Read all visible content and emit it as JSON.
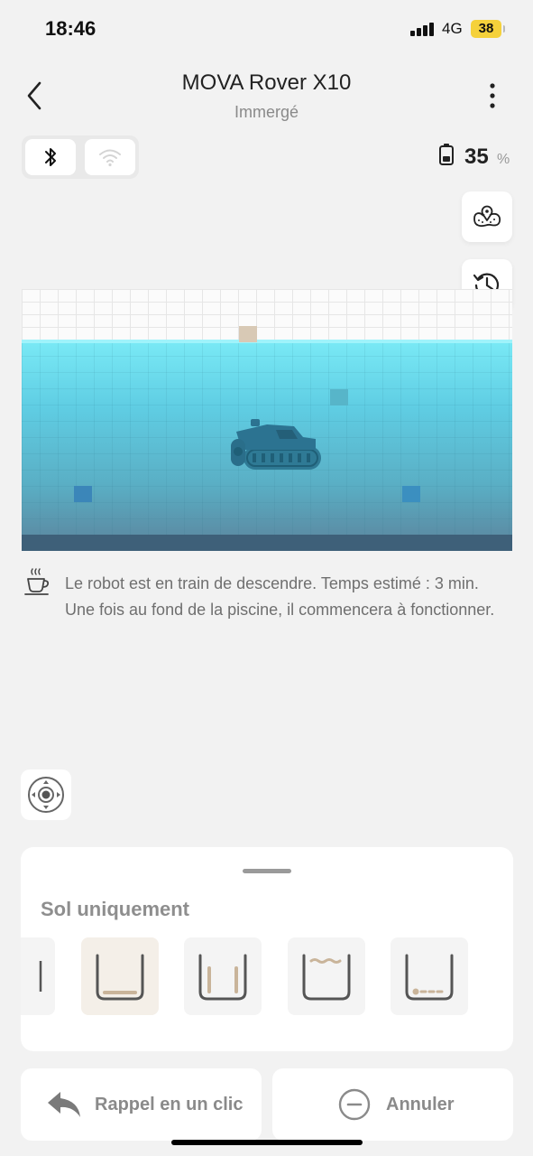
{
  "status_bar": {
    "time": "18:46",
    "network": "4G",
    "battery": "38"
  },
  "header": {
    "title": "MOVA Rover X10",
    "subtitle": "Immergé"
  },
  "icons": {
    "back": "chevron-left-icon",
    "more": "more-vertical-icon",
    "bluetooth": "bluetooth-icon",
    "wifi": "wifi-icon",
    "battery": "battery-icon",
    "map": "map-pin-icon",
    "history": "history-icon",
    "info": "coffee-cup-icon",
    "joystick": "joystick-icon",
    "recall": "return-arrow-icon",
    "cancel": "minus-circle-icon"
  },
  "robot_battery": {
    "value": "35",
    "unit": "%"
  },
  "message": "Le robot est en train de descendre. Temps estimé : 3 min. Une fois au fond de la piscine, il commencera à fonctionner.",
  "mode_panel": {
    "title": "Sol uniquement",
    "modes": [
      "floor-only",
      "walls-and-floor",
      "waterline",
      "floor-path"
    ],
    "selected": "floor-only"
  },
  "actions": {
    "recall": "Rappel en un clic",
    "cancel": "Annuler"
  },
  "colors": {
    "water_top": "#7aeaf6",
    "water_bottom": "#5b8ea6",
    "pool_floor": "#3e6079",
    "accent": "#c9b49a"
  }
}
